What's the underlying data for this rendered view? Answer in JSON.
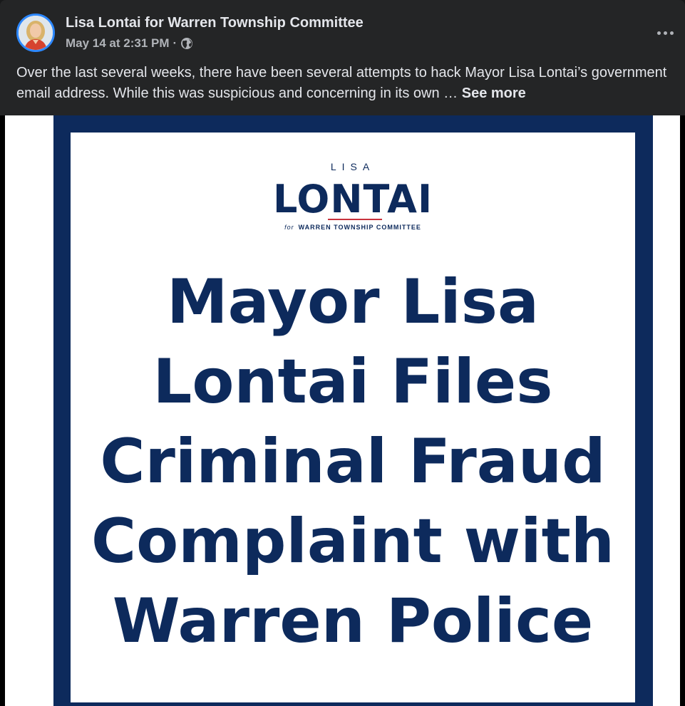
{
  "post": {
    "page_name": "Lisa Lontai for Warren Township Committee",
    "timestamp": "May 14 at 2:31 PM",
    "separator": "·",
    "audience_icon": "globe-icon",
    "more_icon": "more-horizontal-icon",
    "text": "Over the last several weeks, there have been several attempts to hack Mayor Lisa Lontai’s government email address. While this was suspicious and concerning in its own … ",
    "see_more": "See more"
  },
  "graphic": {
    "logo_first_name": "LISA",
    "logo_last_name": "LONTAI",
    "logo_for": "for",
    "logo_subtitle": "WARREN TOWNSHIP COMMITTEE",
    "headline_lines": [
      "Mayor Lisa",
      "Lontai Files",
      "Criminal Fraud",
      "Complaint with",
      "Warren Police"
    ],
    "colors": {
      "navy": "#0d2a5c",
      "accent_red": "#c8323c",
      "avatar_ring": "#2d88ff"
    }
  }
}
